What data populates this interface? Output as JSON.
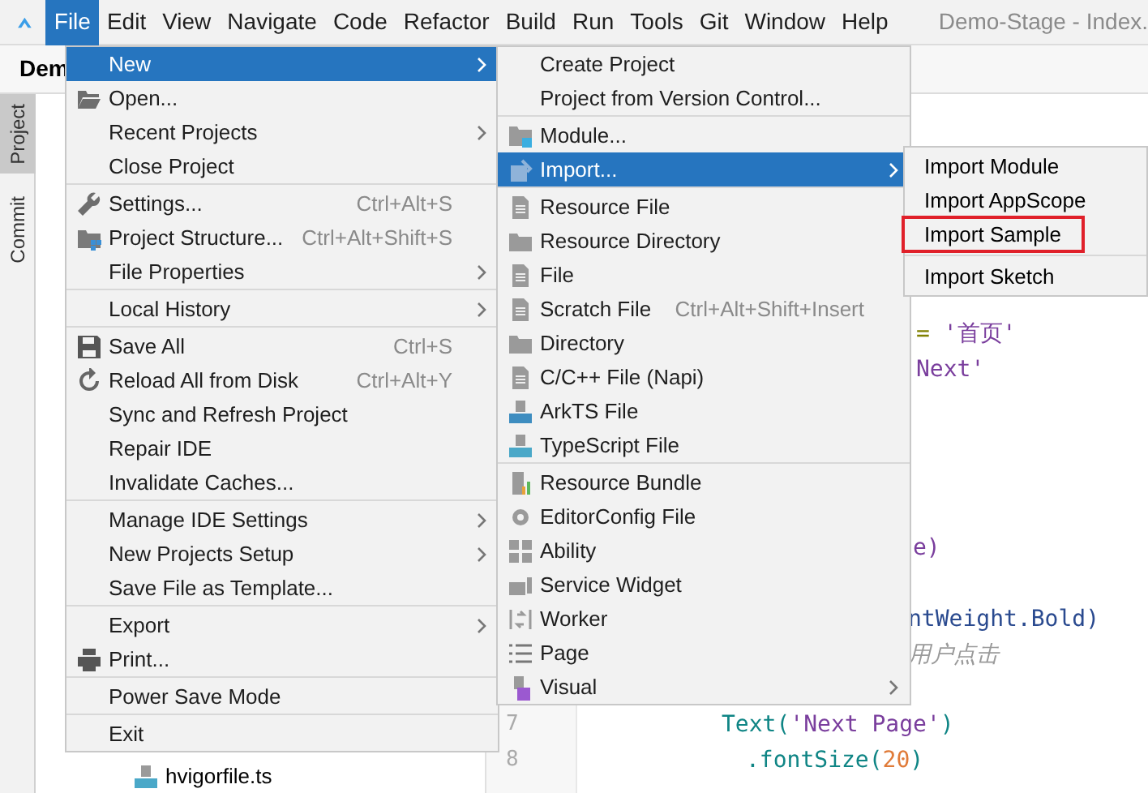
{
  "menubar": {
    "items": [
      {
        "label": "File",
        "selected": true
      },
      {
        "label": "Edit",
        "selected": false
      },
      {
        "label": "View",
        "selected": false
      },
      {
        "label": "Navigate",
        "selected": false
      },
      {
        "label": "Code",
        "selected": false
      },
      {
        "label": "Refactor",
        "selected": false
      },
      {
        "label": "Build",
        "selected": false
      },
      {
        "label": "Run",
        "selected": false
      },
      {
        "label": "Tools",
        "selected": false
      },
      {
        "label": "Git",
        "selected": false
      },
      {
        "label": "Window",
        "selected": false
      },
      {
        "label": "Help",
        "selected": false
      }
    ],
    "title": "Demo-Stage - Index."
  },
  "toolbar": {
    "project_name": "Dem"
  },
  "side_tabs": [
    {
      "label": "Project",
      "selected": true
    },
    {
      "label": "Commit",
      "selected": false
    }
  ],
  "project_tree": {
    "file": "hvigorfile.ts"
  },
  "editor": {
    "line_numbers": [
      "7",
      "8"
    ],
    "lines": [
      {
        "tokens": [
          {
            "text": "= ",
            "color": "#808000"
          },
          {
            "text": "'首页'",
            "color": "#7a3e9d"
          }
        ]
      },
      {
        "tokens": [
          {
            "text": "Next'",
            "color": "#7a3e9d"
          }
        ]
      },
      {
        "tokens": [
          {
            "text": "e)",
            "color": "#7a3e9d"
          }
        ]
      },
      {
        "tokens": [
          {
            "text": "ntWeight.Bold)",
            "color": "#2a4a8f"
          }
        ]
      },
      {
        "tokens": [
          {
            "text": "用户点击",
            "color": "#9a9a9a"
          }
        ]
      },
      {
        "tokens": [
          {
            "text": "Text(",
            "color": "#0f8585"
          },
          {
            "text": "'Next Page'",
            "color": "#7a3e9d"
          },
          {
            "text": ")",
            "color": "#0f8585"
          }
        ]
      },
      {
        "tokens": [
          {
            "text": ".fontSize(",
            "color": "#0f8585"
          },
          {
            "text": "20",
            "color": "#e07b39"
          },
          {
            "text": ")",
            "color": "#0f8585"
          }
        ]
      }
    ]
  },
  "file_menu": [
    {
      "kind": "plain",
      "label": "New",
      "submenu": true,
      "selected": true
    },
    {
      "kind": "openfolder",
      "label": "Open...",
      "selected": false
    },
    {
      "kind": "plain",
      "label": "Recent Projects",
      "submenu": true,
      "selected": false
    },
    {
      "kind": "plain",
      "label": "Close Project",
      "selected": false
    },
    {
      "kind": "separator"
    },
    {
      "kind": "wrench",
      "label": "Settings...",
      "shortcut": "Ctrl+Alt+S",
      "selected": false
    },
    {
      "kind": "structure",
      "label": "Project Structure...",
      "shortcut": "Ctrl+Alt+Shift+S",
      "selected": false
    },
    {
      "kind": "plain",
      "label": "File Properties",
      "submenu": true,
      "selected": false
    },
    {
      "kind": "separator"
    },
    {
      "kind": "plain",
      "label": "Local History",
      "submenu": true,
      "selected": false
    },
    {
      "kind": "separator"
    },
    {
      "kind": "save",
      "label": "Save All",
      "shortcut": "Ctrl+S",
      "selected": false
    },
    {
      "kind": "reload",
      "label": "Reload All from Disk",
      "shortcut": "Ctrl+Alt+Y",
      "selected": false
    },
    {
      "kind": "plain",
      "label": "Sync and Refresh Project",
      "selected": false
    },
    {
      "kind": "plain",
      "label": "Repair IDE",
      "selected": false
    },
    {
      "kind": "plain",
      "label": "Invalidate Caches...",
      "selected": false
    },
    {
      "kind": "separator"
    },
    {
      "kind": "plain",
      "label": "Manage IDE Settings",
      "submenu": true,
      "selected": false
    },
    {
      "kind": "plain",
      "label": "New Projects Setup",
      "submenu": true,
      "selected": false
    },
    {
      "kind": "plain",
      "label": "Save File as Template...",
      "selected": false
    },
    {
      "kind": "separator"
    },
    {
      "kind": "plain",
      "label": "Export",
      "submenu": true,
      "selected": false
    },
    {
      "kind": "print",
      "label": "Print...",
      "selected": false
    },
    {
      "kind": "separator"
    },
    {
      "kind": "plain",
      "label": "Power Save Mode",
      "selected": false
    },
    {
      "kind": "separator"
    },
    {
      "kind": "plain",
      "label": "Exit",
      "selected": false
    }
  ],
  "new_menu": [
    {
      "kind": "plain",
      "label": "Create Project",
      "selected": false
    },
    {
      "kind": "plain",
      "label": "Project from Version Control...",
      "selected": false
    },
    {
      "kind": "separator"
    },
    {
      "kind": "module",
      "label": "Module...",
      "selected": false
    },
    {
      "kind": "import",
      "label": "Import...",
      "submenu": true,
      "selected": true
    },
    {
      "kind": "separator"
    },
    {
      "kind": "file",
      "label": "Resource File",
      "selected": false
    },
    {
      "kind": "folder",
      "label": "Resource Directory",
      "selected": false
    },
    {
      "kind": "file",
      "label": "File",
      "selected": false
    },
    {
      "kind": "file",
      "label": "Scratch File",
      "shortcut": "Ctrl+Alt+Shift+Insert",
      "selected": false
    },
    {
      "kind": "folder",
      "label": "Directory",
      "selected": false
    },
    {
      "kind": "file",
      "label": "C/C++ File (Napi)",
      "selected": false
    },
    {
      "kind": "ets",
      "label": "ArkTS File",
      "selected": false
    },
    {
      "kind": "ts",
      "label": "TypeScript File",
      "selected": false
    },
    {
      "kind": "separator"
    },
    {
      "kind": "bundle",
      "label": "Resource Bundle",
      "selected": false
    },
    {
      "kind": "gear",
      "label": "EditorConfig File",
      "selected": false
    },
    {
      "kind": "grid",
      "label": "Ability",
      "selected": false
    },
    {
      "kind": "widget",
      "label": "Service Widget",
      "selected": false
    },
    {
      "kind": "worker",
      "label": "Worker",
      "selected": false
    },
    {
      "kind": "list",
      "label": "Page",
      "selected": false
    },
    {
      "kind": "visual",
      "label": "Visual",
      "submenu": true,
      "selected": false
    }
  ],
  "import_menu": [
    {
      "kind": "item",
      "label": "Import Module",
      "outlined": false
    },
    {
      "kind": "item",
      "label": "Import AppScope",
      "outlined": false
    },
    {
      "kind": "item",
      "label": "Import Sample",
      "outlined": true
    },
    {
      "kind": "separator"
    },
    {
      "kind": "item",
      "label": "Import Sketch",
      "outlined": false
    }
  ]
}
